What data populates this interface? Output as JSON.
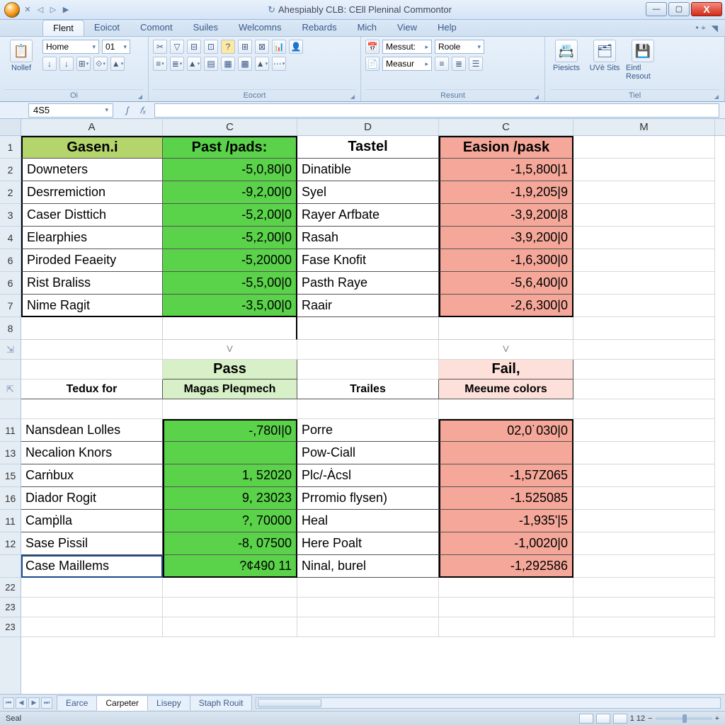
{
  "window": {
    "title": "Ahespiably CLB: CEll Pleninal Commontor"
  },
  "menu": {
    "tabs": [
      "Flent",
      "Eoicot",
      "Comont",
      "Suiles",
      "Welcomns",
      "Rebards",
      "Mich",
      "View",
      "Help"
    ],
    "active_index": 0
  },
  "ribbon": {
    "groups": [
      {
        "label": "Oi",
        "big": {
          "name": "Nollef"
        },
        "combos": [
          {
            "value": "Home"
          },
          {
            "value": "01"
          }
        ]
      },
      {
        "label": "Eocort"
      },
      {
        "label": "Resunt",
        "big": {
          "name": "Messur:"
        },
        "combos": [
          {
            "value": "Messut:"
          },
          {
            "value": "Measur"
          },
          {
            "value": "Roole"
          }
        ]
      },
      {
        "label": "Tiel",
        "buttons": [
          {
            "name": "Piesicts"
          },
          {
            "name": "UVè Sits"
          },
          {
            "name": "Eintl Resout"
          }
        ]
      }
    ]
  },
  "formula_bar": {
    "name_box": "4S5",
    "formula": ""
  },
  "columns": [
    "A",
    "C",
    "D",
    "C",
    "M"
  ],
  "row_numbers_top": [
    "1",
    "2",
    "2",
    "3",
    "4",
    "6",
    "6",
    "7",
    "8"
  ],
  "row_icons_mid": [
    "⇲",
    "",
    "⇱",
    ""
  ],
  "row_numbers_bot": [
    "",
    "11",
    "13",
    "15",
    "16",
    "11",
    "12",
    "",
    "22",
    "23",
    "23"
  ],
  "table1": {
    "headers": [
      "Gasen.i",
      "Past /pads:",
      "Tastel",
      "Easion /pask"
    ],
    "rows": [
      [
        "Downeters",
        "-5,0,80|0",
        "Dinatible",
        "-1,5,800|1"
      ],
      [
        "Desrremiction",
        "-9,2,00|0",
        "Syel",
        "-1,9,205|9"
      ],
      [
        "Caser Disttich",
        "-5,2,00|0",
        "Rayer Arfbate",
        "-3,9,200|8"
      ],
      [
        "Elearphies",
        "-5,2,00|0",
        "Rasah",
        "-3,9,200|0"
      ],
      [
        "Piroded Feaeity",
        "-5,20000",
        "Fase Knofit",
        "-1,6,300|0"
      ],
      [
        "Rist Braliss",
        "-5,5,00|0",
        "Pasth Raye",
        "-5,6,400|0"
      ],
      [
        "Nime Ragit",
        "-3,5,00|0",
        "Raair",
        "-2,6,300|0"
      ]
    ]
  },
  "mid_labels": {
    "pass": "Pass",
    "fail": "Fail,"
  },
  "table2": {
    "headers": [
      "Tedux for",
      "Magas Pleqmech",
      "Trailes",
      "Meeume colors"
    ],
    "rows": [
      [
        "Nansdean Lolles",
        "-,780I|0",
        "Porre",
        "02,0˙030|0"
      ],
      [
        "Necalion Knors",
        "",
        "Pow-Ciall",
        ""
      ],
      [
        "Carṅbux",
        "1, 52020",
        "Plc/-Ȧcsl",
        "-1,57Z065"
      ],
      [
        "Diador Rogit",
        "9, 23023",
        "Prromio flysen)",
        "-1.525085"
      ],
      [
        "Camṗlla",
        "?, 70000",
        "Heal",
        "-1,935'|5"
      ],
      [
        "Sase Pissil",
        "-8, 07500",
        "Here Poalt",
        "-1,0020|0"
      ],
      [
        "Case Maillems",
        "?¢490 11",
        "Ninal, burel",
        "-1,292586"
      ]
    ]
  },
  "sheet_tabs": {
    "tabs": [
      "Earce",
      "Carpeter",
      "Lisepy",
      "Staph Rouit"
    ],
    "active_index": 1
  },
  "status": {
    "left": "Seal",
    "zoom": "1 12"
  }
}
